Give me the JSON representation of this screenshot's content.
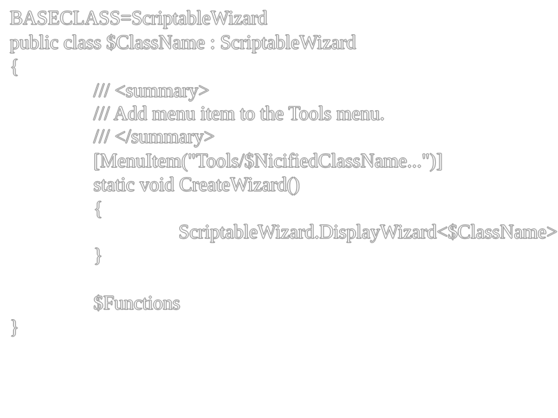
{
  "code": {
    "header_comment": "BASECLASS=ScriptableWizard",
    "class_declaration": "public class $ClassName : ScriptableWizard",
    "class_open_brace": "{",
    "summary_open": "/// <summary>",
    "summary_text": "/// Add menu item to the Tools menu.",
    "summary_close": "/// </summary>",
    "attribute": "[MenuItem(\"Tools/$NicifiedClassName...\")]",
    "method_signature": "static void CreateWizard()",
    "method_open_brace": "{",
    "method_body": "ScriptableWizard.DisplayWizard<$ClassName>",
    "method_close_brace": "}",
    "functions_placeholder": "$Functions",
    "class_close_brace": "}"
  }
}
